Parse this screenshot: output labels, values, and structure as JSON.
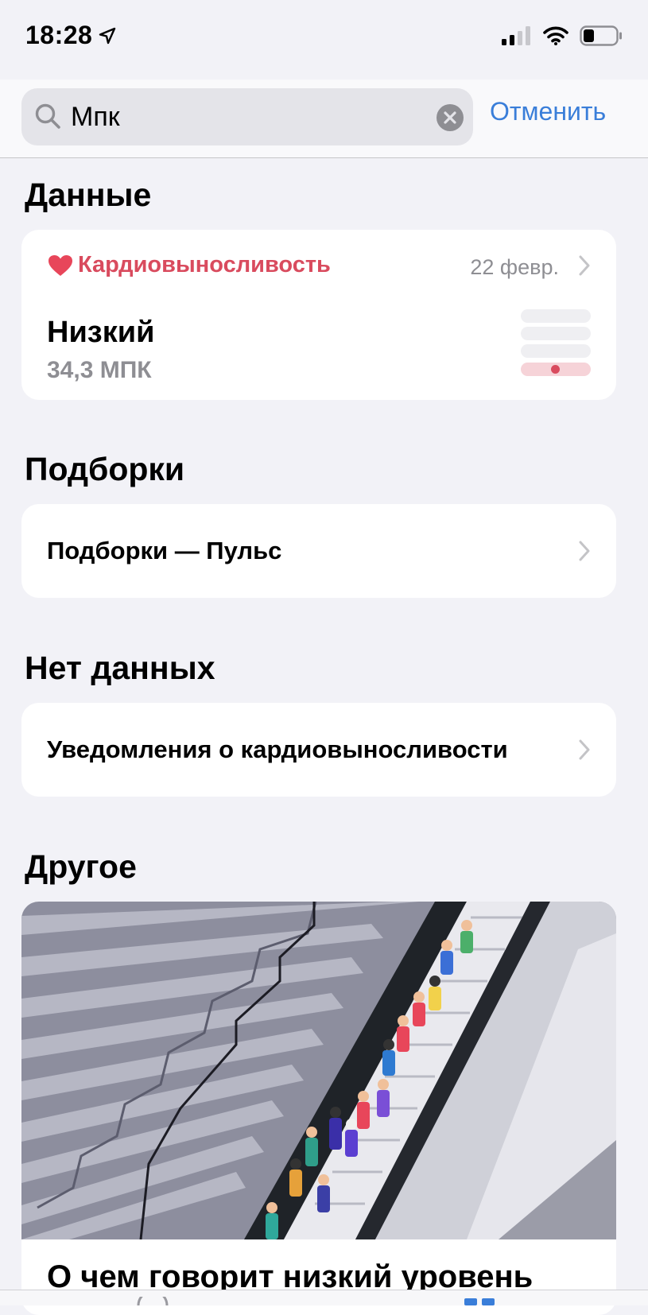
{
  "status_bar": {
    "time": "18:28"
  },
  "search": {
    "value": "Мпк",
    "cancel_label": "Отменить"
  },
  "sections": {
    "data": {
      "title": "Данные",
      "card": {
        "category": "Кардиовыносливость",
        "date": "22 февр.",
        "value": "Низкий",
        "subvalue": "34,3 МПК",
        "level": {
          "total_levels": 4,
          "current_level": 1
        }
      }
    },
    "collections": {
      "title": "Подборки",
      "item": "Подборки — Пульс"
    },
    "no_data": {
      "title": "Нет данных",
      "item": "Уведомления о кардиовыносливости"
    },
    "other": {
      "title": "Другое",
      "article_title": "О чем говорит низкий уровень"
    }
  },
  "colors": {
    "accent_blue": "#3a7ed9",
    "heart_red": "#d94b5e",
    "background": "#f2f2f7",
    "secondary_text": "#8e8e93"
  }
}
